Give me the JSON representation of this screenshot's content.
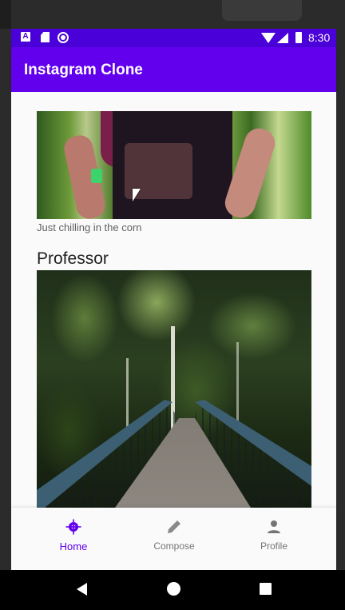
{
  "status_bar": {
    "time": "8:30",
    "icons": [
      "a-notification-icon",
      "sd-card-icon",
      "circle-notification-icon",
      "wifi-icon",
      "signal-icon",
      "battery-icon"
    ],
    "background": "#4a00d9"
  },
  "app_bar": {
    "title": "Instagram Clone",
    "background": "#6200ee"
  },
  "feed": {
    "posts": [
      {
        "image_description": "person in band t-shirt in a cornfield",
        "caption": "Just chilling in the corn"
      },
      {
        "username": "Professor",
        "image_description": "wooden footbridge leading into a forest"
      }
    ]
  },
  "bottom_nav": {
    "items": [
      {
        "label": "Home",
        "icon": "home-crosshair-icon",
        "active": true
      },
      {
        "label": "Compose",
        "icon": "pencil-icon",
        "active": false
      },
      {
        "label": "Profile",
        "icon": "person-icon",
        "active": false
      }
    ],
    "active_color": "#6200ee",
    "inactive_color": "#757575"
  },
  "system_nav": {
    "buttons": [
      "back-icon",
      "home-icon",
      "recents-icon"
    ]
  }
}
